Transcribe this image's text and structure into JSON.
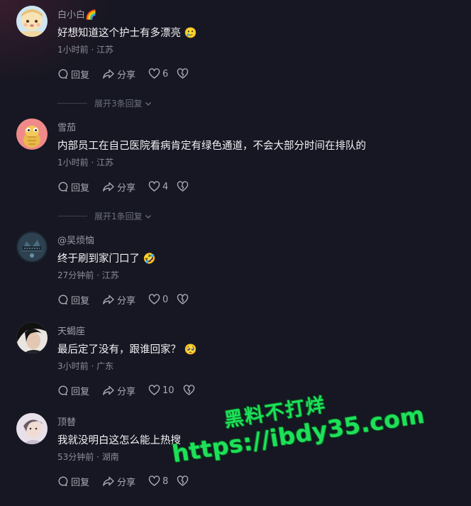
{
  "comments": [
    {
      "username": "白小白🌈",
      "text": "好想知道这个护士有多漂亮 🥲",
      "meta": "1小时前 · 江苏",
      "reply": "回复",
      "share": "分享",
      "likes": "6",
      "expand": "展开3条回复"
    },
    {
      "username": "雪茄",
      "text": "内部员工在自己医院看病肯定有绿色通道，不会大部分时间在排队的",
      "meta": "1小时前 · 江苏",
      "reply": "回复",
      "share": "分享",
      "likes": "4",
      "expand": "展开1条回复"
    },
    {
      "username": "@吴烦恼",
      "text": "终于刷到家门口了 🤣",
      "meta": "27分钟前 · 江苏",
      "reply": "回复",
      "share": "分享",
      "likes": "0"
    },
    {
      "username": "天蝎座",
      "text": "最后定了没有，跟谁回家？ 🥺",
      "meta": "3小时前 · 广东",
      "reply": "回复",
      "share": "分享",
      "likes": "10"
    },
    {
      "username": "顶替",
      "text": "我就没明白这怎么能上热搜",
      "meta": "53分钟前 · 湖南",
      "reply": "回复",
      "share": "分享",
      "likes": "8"
    }
  ],
  "watermark": {
    "line1": "黑料不打烊",
    "line2": "https://ibdy35.com",
    "color": "#1ee05a"
  },
  "colors": {
    "background": "#161722",
    "username": "#9a9ba6",
    "body": "#f2f2f6",
    "meta": "#8b8c98"
  }
}
